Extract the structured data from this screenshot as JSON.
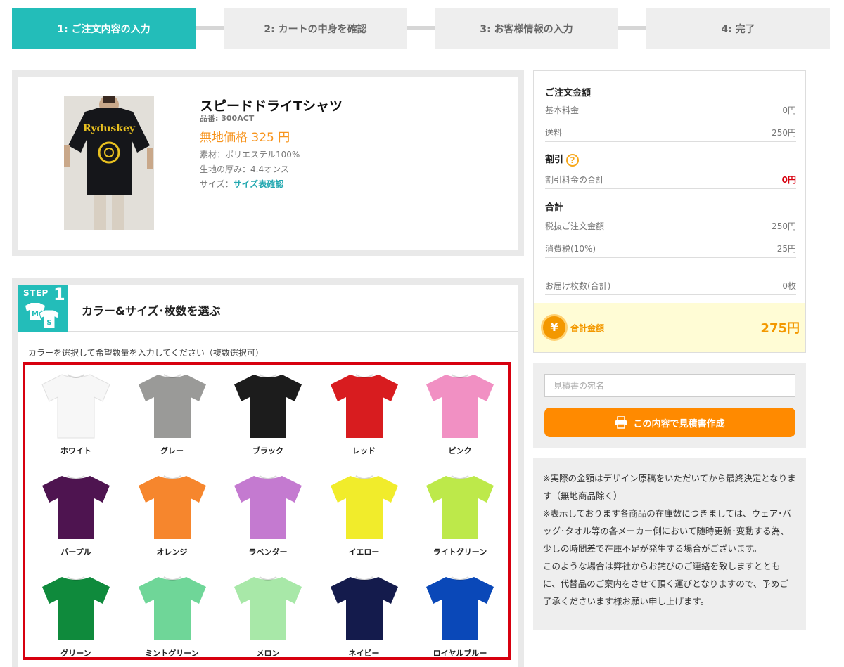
{
  "steps": [
    "1: ご注文内容の入力",
    "2: カートの中身を確認",
    "3: お客様情報の入力",
    "4: 完了"
  ],
  "product": {
    "name": "スピードドライTシャツ",
    "sku": "品番: 300ACT",
    "price_label": "無地価格 325 円",
    "material": "素材：ポリエステル100%",
    "thickness": "生地の厚み：4.4オンス",
    "size_label": "サイズ：",
    "size_link": "サイズ表確認"
  },
  "step1": {
    "badge_text": "STEP",
    "badge_num": "1",
    "badge_m": "M",
    "badge_s": "S",
    "title": "カラー&サイズ･枚数を選ぶ",
    "instruction": "カラーを選択して希望数量を入力してください（複数選択可）",
    "colors": [
      {
        "name": "ホワイト",
        "hex": "#f7f7f7"
      },
      {
        "name": "グレー",
        "hex": "#9a9a98"
      },
      {
        "name": "ブラック",
        "hex": "#1c1c1c"
      },
      {
        "name": "レッド",
        "hex": "#d81c1f"
      },
      {
        "name": "ピンク",
        "hex": "#f190c3"
      },
      {
        "name": "パープル",
        "hex": "#4e1450"
      },
      {
        "name": "オレンジ",
        "hex": "#f6862d"
      },
      {
        "name": "ラベンダー",
        "hex": "#c47ad0"
      },
      {
        "name": "イエロー",
        "hex": "#f1ec2b"
      },
      {
        "name": "ライトグリーン",
        "hex": "#bde94a"
      },
      {
        "name": "グリーン",
        "hex": "#0f8a3c"
      },
      {
        "name": "ミントグリーン",
        "hex": "#6fd698"
      },
      {
        "name": "メロン",
        "hex": "#a8e8a8"
      },
      {
        "name": "ネイビー",
        "hex": "#141b4c"
      },
      {
        "name": "ロイヤルブルー",
        "hex": "#0a48b8"
      }
    ]
  },
  "summary": {
    "order_head": "ご注文金額",
    "base_label": "基本料金",
    "base_val": "0円",
    "ship_label": "送料",
    "ship_val": "250円",
    "discount_head": "割引",
    "discount_icon": "?",
    "discount_label": "割引料金の合計",
    "discount_val": "0円",
    "total_head": "合計",
    "pretax_label": "税抜ご注文金額",
    "pretax_val": "250円",
    "tax_label": "消費税(10%)",
    "tax_val": "25円",
    "qty_label": "お届け枚数(合計)",
    "qty_val": "0枚",
    "yen_icon": "¥",
    "grand_label": "合計金額",
    "grand_val": "275円"
  },
  "quote": {
    "placeholder": "見積書の宛名",
    "button": "この内容で見積書作成"
  },
  "notes": [
    "※実際の金額はデザイン原稿をいただいてから最終決定となります（無地商品除く）",
    "※表示しております各商品の在庫数につきましては、ウェア･バッグ･タオル等の各メーカー側において随時更新･変動する為、少しの時間差で在庫不足が発生する場合がございます。",
    "このような場合は弊社からお詫びのご連絡を致しますとともに、代替品のご案内をさせて頂く運びとなりますので、予めご了承くださいます様お願い申し上げます。"
  ]
}
